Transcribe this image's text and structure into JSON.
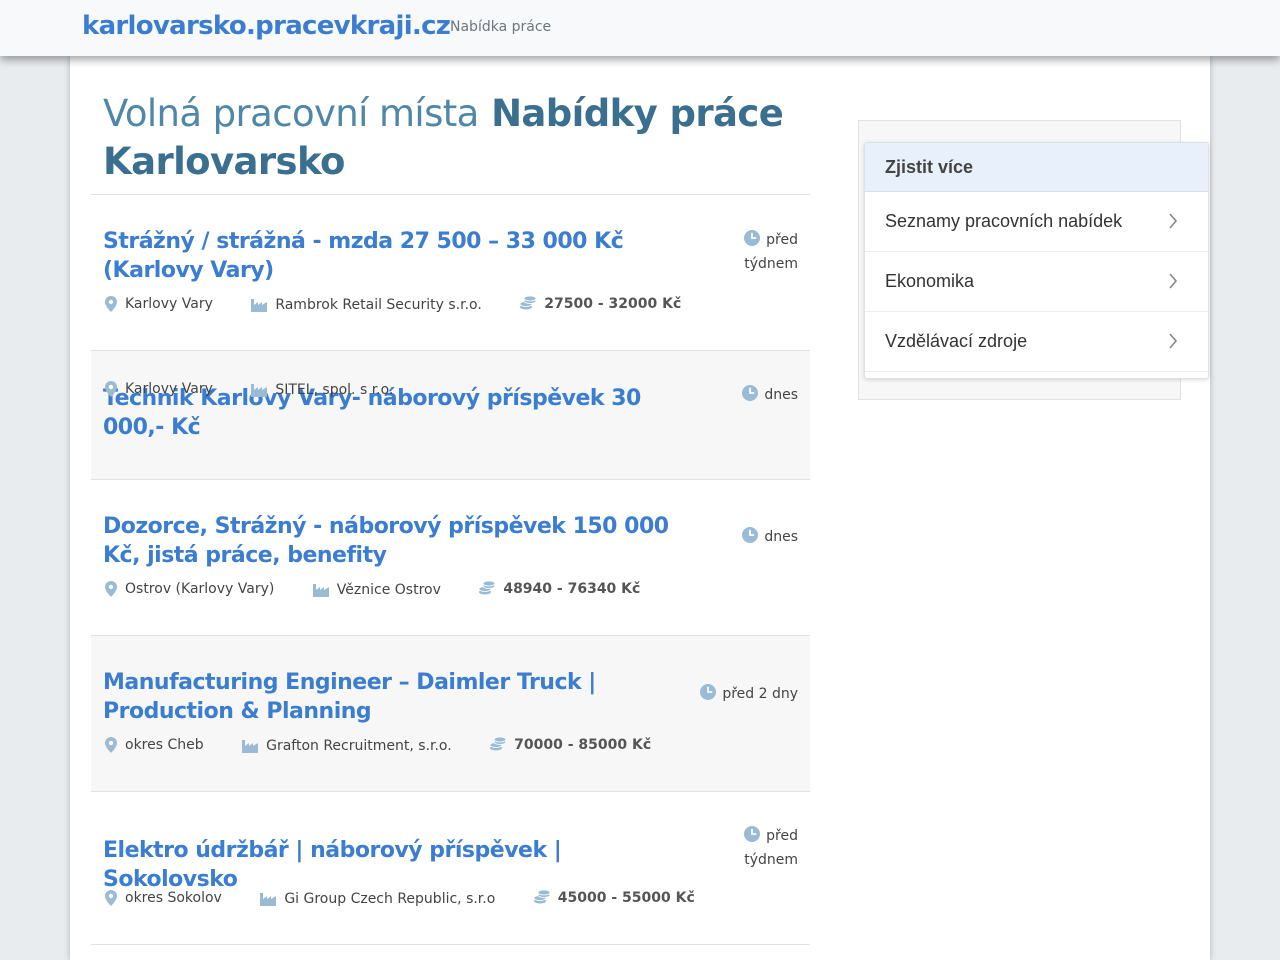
{
  "navbar": {
    "brand": "karlovarsko.pracevkraji.cz",
    "link": "Nabídka práce"
  },
  "page": {
    "title_light": "Volná pracovní místa",
    "title_strong": "Nabídky práce Karlovarsko"
  },
  "jobs": [
    {
      "title": "Strážný / strážná - mzda 27 500 – 33 000 Kč (Karlovy Vary)",
      "time": "před týdnem",
      "location": "Karlovy Vary",
      "company": "Rambrok Retail Security s.r.o.",
      "salary": "27500 - 32000 Kč"
    },
    {
      "title": "Technik Karlovy Vary- náborový příspěvek 30 000,- Kč",
      "time": "dnes",
      "location": "Karlovy Vary",
      "company": "SITEL, spol. s r.o.",
      "salary": ""
    },
    {
      "title": "Dozorce, Strážný - náborový příspěvek 150 000 Kč, jistá práce, benefity",
      "time": "dnes",
      "location": "Ostrov (Karlovy Vary)",
      "company": "Věznice Ostrov",
      "salary": "48940 - 76340 Kč"
    },
    {
      "title": "Manufacturing Engineer – Daimler Truck | Production & Planning",
      "time": "před 2 dny",
      "location": "okres Cheb",
      "company": "Grafton Recruitment, s.r.o.",
      "salary": "70000 - 85000 Kč"
    },
    {
      "title": "Elektro údržbář | náborový příspěvek | Sokolovsko",
      "time": "před týdnem",
      "location": "okres Sokolov",
      "company": "Gi Group Czech Republic, s.r.o",
      "salary": "45000 - 55000 Kč"
    }
  ],
  "sidebar": {
    "header": "Zjistit více",
    "items": [
      {
        "label": "Seznamy pracovních nabídek"
      },
      {
        "label": "Ekonomika"
      },
      {
        "label": "Vzdělávací zdroje"
      }
    ]
  },
  "icons": {
    "time": "clock-icon",
    "location": "map-pin-icon",
    "company": "factory-icon",
    "salary": "coins-icon",
    "sidebar_item": "chevron-right-icon"
  },
  "colors": {
    "brand": "#3a7dd1",
    "title": "#3a6f8f",
    "icon": "#9bbbd4",
    "card_header_bg": "#e8f0fc"
  }
}
